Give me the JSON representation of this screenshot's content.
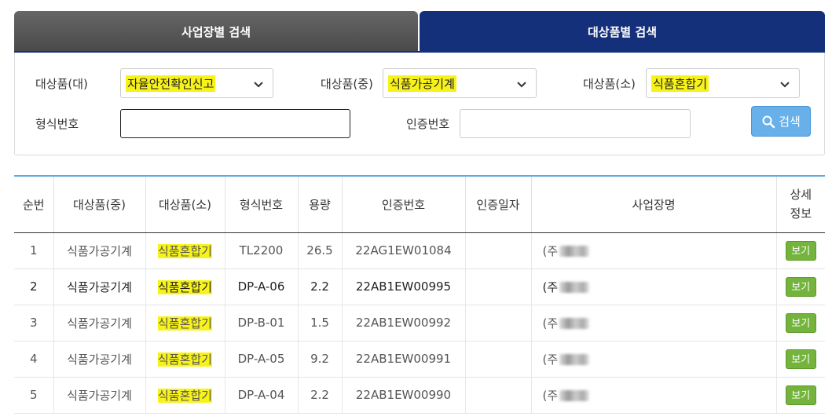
{
  "tabs": {
    "business": "사업장별 검색",
    "product": "대상품별 검색"
  },
  "filters": {
    "large_label": "대상품(대)",
    "large_value": "자율안전확인신고",
    "medium_label": "대상품(중)",
    "medium_value": "식품가공기계",
    "small_label": "대상품(소)",
    "small_value": "식품혼합기",
    "model_label": "형식번호",
    "model_value": "",
    "cert_label": "인증번호",
    "cert_value": "",
    "search_label": "검색"
  },
  "table": {
    "headers": [
      "순번",
      "대상품(중)",
      "대상품(소)",
      "형식번호",
      "용량",
      "인증번호",
      "인증일자",
      "사업장명",
      "상세\n정보"
    ],
    "rows": [
      {
        "no": "1",
        "medium": "식품가공기계",
        "small": "식품혼합기",
        "model": "TL2200",
        "capacity": "26.5",
        "cert": "22AG1EW01084",
        "date": "",
        "company": "(주",
        "view": "보기"
      },
      {
        "no": "2",
        "medium": "식품가공기계",
        "small": "식품혼합기",
        "model": "DP-A-06",
        "capacity": "2.2",
        "cert": "22AB1EW00995",
        "date": "",
        "company": "(주",
        "view": "보기"
      },
      {
        "no": "3",
        "medium": "식품가공기계",
        "small": "식품혼합기",
        "model": "DP-B-01",
        "capacity": "1.5",
        "cert": "22AB1EW00992",
        "date": "",
        "company": "(주",
        "view": "보기"
      },
      {
        "no": "4",
        "medium": "식품가공기계",
        "small": "식품혼합기",
        "model": "DP-A-05",
        "capacity": "9.2",
        "cert": "22AB1EW00991",
        "date": "",
        "company": "(주",
        "view": "보기"
      },
      {
        "no": "5",
        "medium": "식품가공기계",
        "small": "식품혼합기",
        "model": "DP-A-04",
        "capacity": "2.2",
        "cert": "22AB1EW00990",
        "date": "",
        "company": "(주",
        "view": "보기"
      }
    ]
  },
  "colors": {
    "tab_active": "#14307a",
    "tab_inactive": "#555555",
    "highlight": "#f7f21a",
    "view_button": "#74b43c",
    "search_button": "#67b0ea"
  }
}
